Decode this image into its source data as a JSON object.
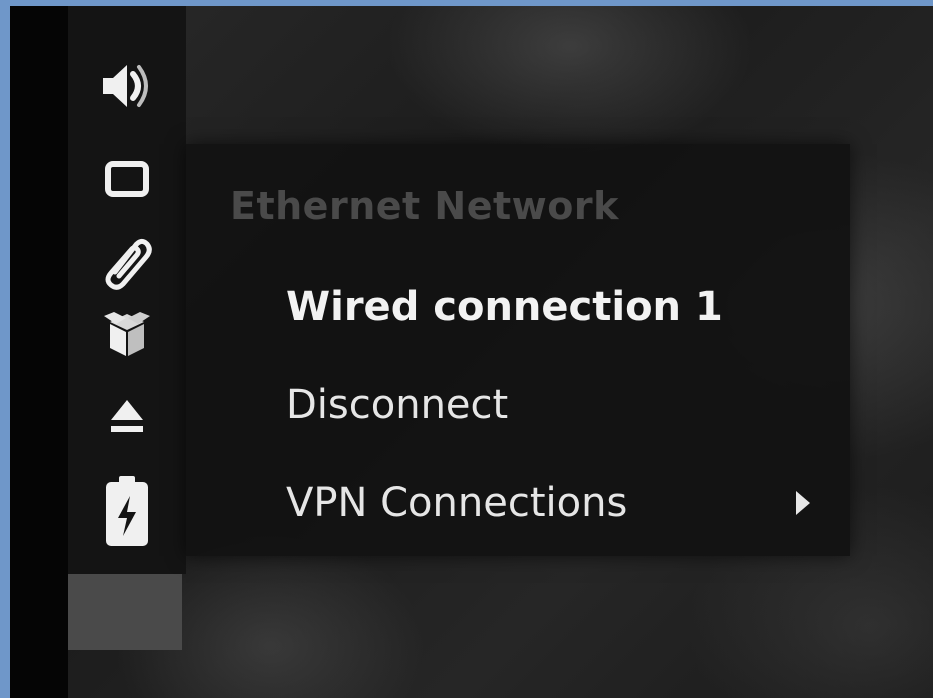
{
  "tray": {
    "icons": [
      "volume-icon",
      "network-display-icon",
      "paperclip-icon",
      "package-icon",
      "eject-icon",
      "battery-charging-icon"
    ]
  },
  "network_menu": {
    "header": "Ethernet Network",
    "items": [
      {
        "label": "Wired connection 1",
        "active": true
      },
      {
        "label": "Disconnect",
        "active": false
      },
      {
        "label": "VPN Connections",
        "active": false,
        "has_submenu": true
      }
    ]
  },
  "colors": {
    "desktop_frame": "#6f97c9",
    "menu_background": "#121212",
    "header_text": "#4a4a4a",
    "item_text": "#e6e6e6"
  }
}
